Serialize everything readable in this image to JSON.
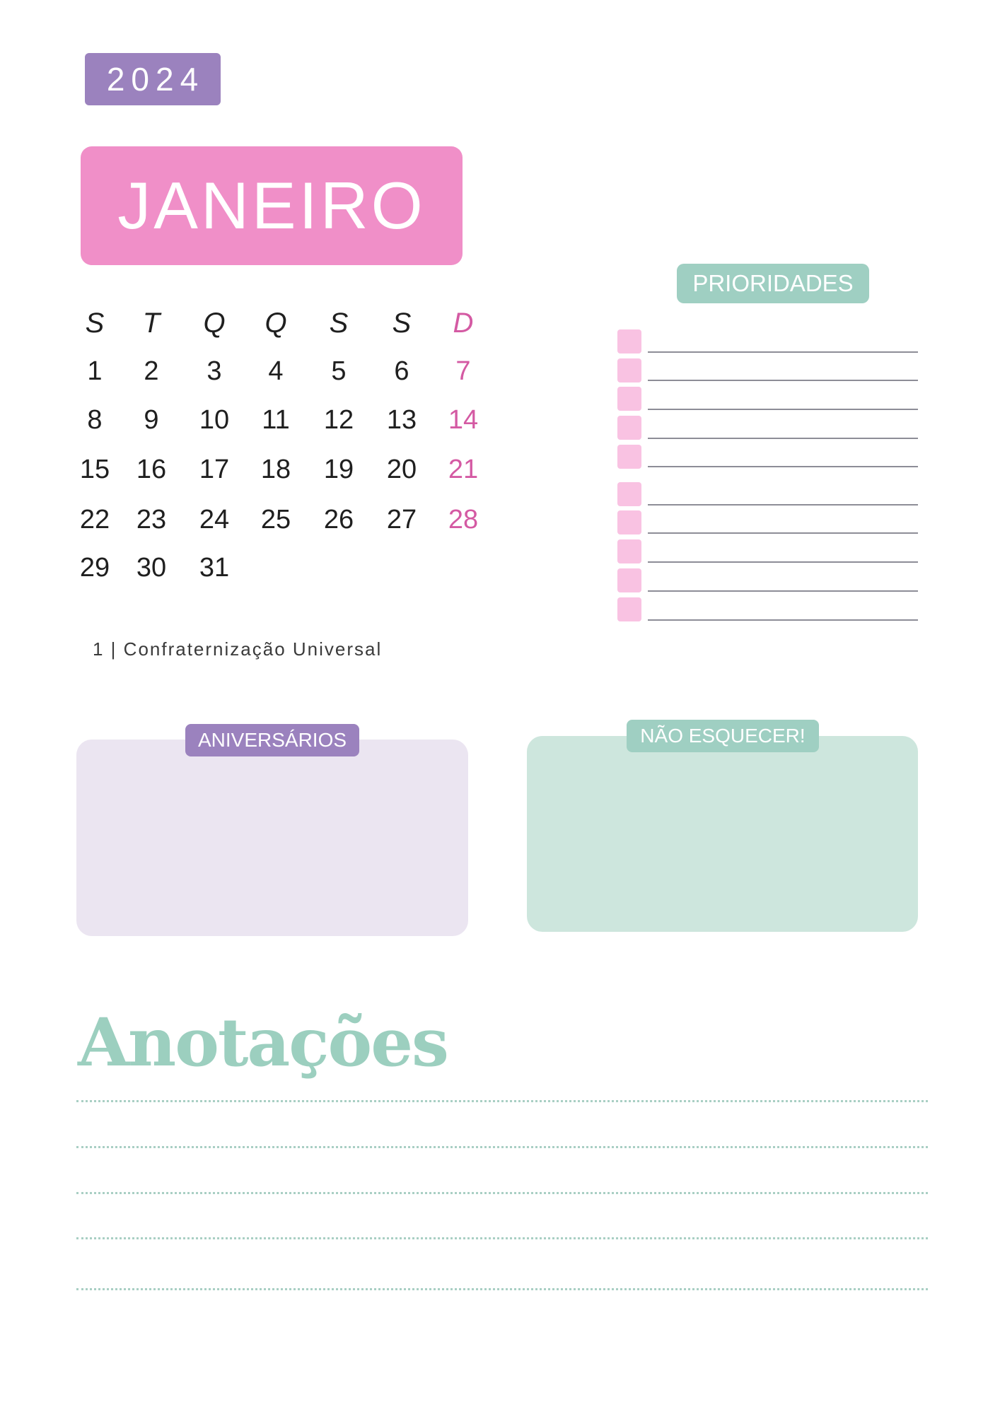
{
  "year": "2024",
  "month": "JANEIRO",
  "calendar": {
    "weekdays": [
      "S",
      "T",
      "Q",
      "Q",
      "S",
      "S",
      "D"
    ],
    "weeks": [
      [
        "1",
        "2",
        "3",
        "4",
        "5",
        "6",
        "7"
      ],
      [
        "8",
        "9",
        "10",
        "11",
        "12",
        "13",
        "14"
      ],
      [
        "15",
        "16",
        "17",
        "18",
        "19",
        "20",
        "21"
      ],
      [
        "22",
        "23",
        "24",
        "25",
        "26",
        "27",
        "28"
      ],
      [
        "29",
        "30",
        "31",
        "",
        "",
        "",
        ""
      ]
    ]
  },
  "holiday": "1 | Confraternização Universal",
  "priorities": {
    "title": "PRIORIDADES",
    "item_count": 10
  },
  "aniversarios": {
    "title": "ANIVERSÁRIOS"
  },
  "nao_esquecer": {
    "title": "NÃO ESQUECER!"
  },
  "anotacoes": {
    "title": "Anotações"
  },
  "colors": {
    "year_badge": "#9b82be",
    "month_banner": "#f08fc8",
    "sunday_text": "#d45aa3",
    "priority_checkbox": "#f9c2e2",
    "mint_accent": "#9fcfc2",
    "lavender_box": "#ebe5f1",
    "mint_box": "#cde6dd"
  }
}
